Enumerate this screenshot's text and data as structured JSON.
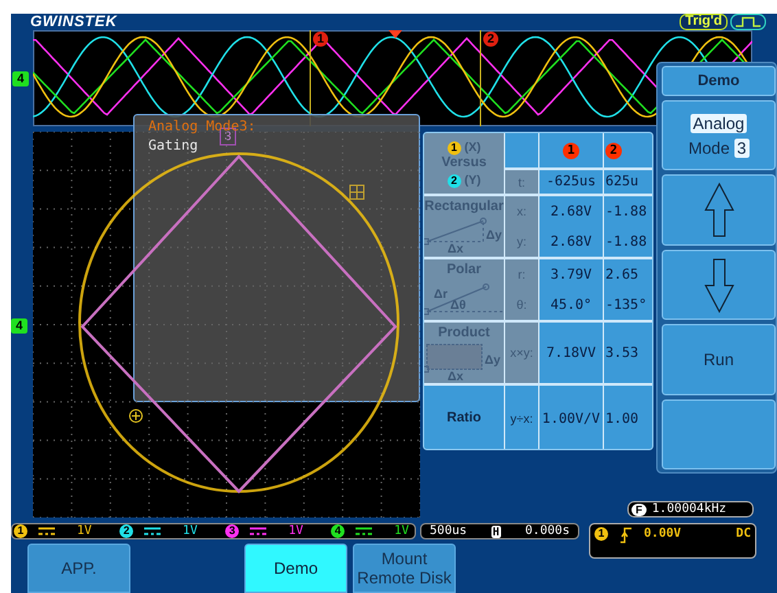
{
  "header": {
    "logo": "GWINSTEK",
    "trigger_status": "Trig'd"
  },
  "strip": {
    "channel_marker": "4",
    "cursors": [
      "1",
      "2"
    ]
  },
  "graticule": {
    "channel_marker": "4"
  },
  "analog_window": {
    "title": "Analog Mode3:",
    "subtitle": "Gating",
    "marker": "3"
  },
  "measurements": {
    "cursor_heads": [
      "1",
      "2"
    ],
    "groups": [
      {
        "kind": "versus",
        "x_channel": "1",
        "x_label": "(X)",
        "word": "Versus",
        "y_channel": "2",
        "y_label": "(Y)",
        "rows": [
          {
            "var": "t:",
            "v1": "-625us",
            "v2": "625u"
          }
        ]
      },
      {
        "kind": "rectangular",
        "label": "Rectangular",
        "marks": [
          "Δy",
          "Δx"
        ],
        "rows": [
          {
            "var": "x:",
            "v1": "2.68V",
            "v2": "-1.88"
          },
          {
            "var": "y:",
            "v1": "2.68V",
            "v2": "-1.88"
          }
        ]
      },
      {
        "kind": "polar",
        "label": "Polar",
        "marks": [
          "Δr",
          "Δθ"
        ],
        "rows": [
          {
            "var": "r:",
            "v1": "3.79V",
            "v2": "2.65"
          },
          {
            "var": "θ:",
            "v1": "45.0°",
            "v2": "-135°"
          }
        ]
      },
      {
        "kind": "product",
        "label": "Product",
        "marks": [
          "Δy",
          "Δx"
        ],
        "rows": [
          {
            "var": "x×y:",
            "v1": "7.18VV",
            "v2": "3.53"
          }
        ]
      },
      {
        "kind": "ratio",
        "label": "Ratio",
        "rows": [
          {
            "var": "y÷x:",
            "v1": "1.00V/V",
            "v2": "1.00"
          }
        ]
      }
    ]
  },
  "frequency": {
    "marker": "F",
    "value": "1.00004kHz"
  },
  "menu": {
    "title": "Demo",
    "items": [
      {
        "kind": "mode",
        "option": "Analog",
        "label": "Mode",
        "value": "3"
      },
      {
        "kind": "up"
      },
      {
        "kind": "down"
      },
      {
        "kind": "action",
        "label": "Run"
      },
      {
        "kind": "blank"
      }
    ]
  },
  "channels": [
    {
      "number": "1",
      "scale": "1V",
      "color": "#f0c010"
    },
    {
      "number": "2",
      "scale": "1V",
      "color": "#20e0e8"
    },
    {
      "number": "3",
      "scale": "1V",
      "color": "#ff30f0"
    },
    {
      "number": "4",
      "scale": "1V",
      "color": "#20e020"
    }
  ],
  "timebase": {
    "scale": "500us",
    "marker": "H",
    "position": "0.000s"
  },
  "trigger": {
    "channel": "1",
    "voltage": "0.00V",
    "coupling": "DC"
  },
  "softkeys": [
    {
      "kind": "key",
      "label": "APP.",
      "selected": false
    },
    {
      "kind": "empty"
    },
    {
      "kind": "key",
      "label": "Demo",
      "selected": true
    },
    {
      "kind": "key",
      "label": "Mount Remote Disk",
      "selected": false
    }
  ]
}
